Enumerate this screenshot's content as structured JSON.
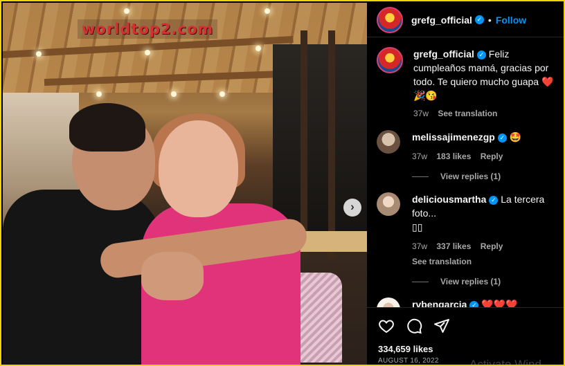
{
  "watermark": "worldtop2.com",
  "post": {
    "username": "grefg_official",
    "follow_label": "Follow",
    "caption_text": "Feliz cumpleaños mamá, gracias por todo. Te quiero mucho guapa",
    "caption_emojis": "❤️🎉😘",
    "caption_time": "37w",
    "see_translation": "See translation"
  },
  "comments": [
    {
      "username": "melissajimenezgp",
      "text": "",
      "emoji": "🤩",
      "time": "37w",
      "likes": "183 likes",
      "reply": "Reply",
      "replies_label": "View replies (1)"
    },
    {
      "username": "deliciousmartha",
      "text": "La tercera foto...",
      "text2": "▯▯",
      "time": "37w",
      "likes": "337 likes",
      "reply": "Reply",
      "see_translation": "See translation",
      "replies_label": "View replies (1)"
    },
    {
      "username": "rvbengarcia",
      "emoji": "❤️❤️❤️"
    }
  ],
  "footer": {
    "likes": "334,659 likes",
    "date": "AUGUST 16, 2022"
  },
  "overlay_text": "Activate Wind",
  "icons": [
    "heart-icon",
    "comment-icon",
    "share-icon",
    "next-arrow-icon",
    "verified-badge-icon"
  ]
}
